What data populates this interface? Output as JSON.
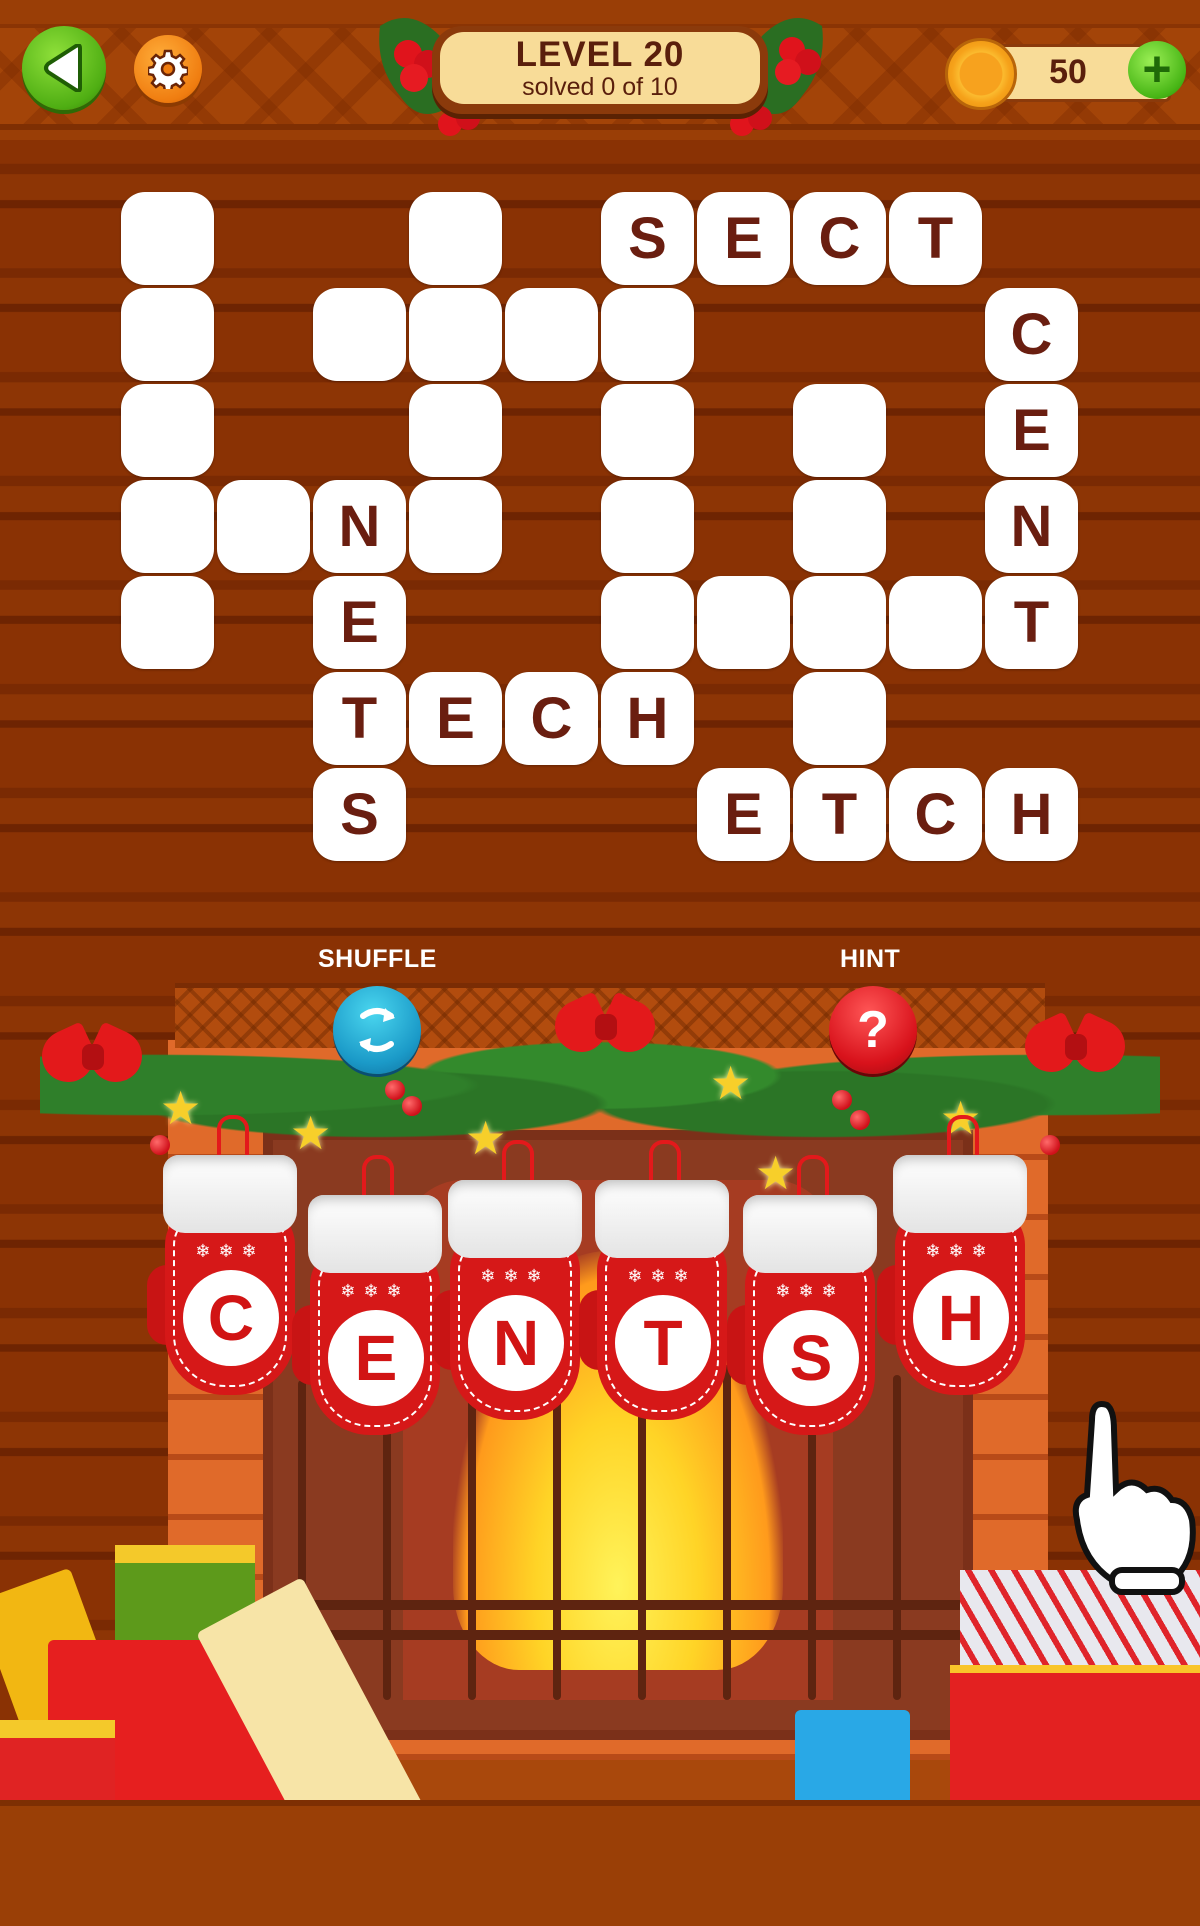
{
  "header": {
    "back_icon": "back-arrow-icon",
    "settings_icon": "gear-icon",
    "level_title": "LEVEL 20",
    "progress_text": "solved 0 of 10",
    "solved": 0,
    "total": 10,
    "coins": "50",
    "coin_icon": "coin-icon",
    "add_coins_icon": "plus-icon"
  },
  "grid": {
    "columns": 10,
    "rows": 7,
    "cells": [
      {
        "r": 0,
        "c": 0,
        "letter": ""
      },
      {
        "r": 0,
        "c": 3,
        "letter": ""
      },
      {
        "r": 0,
        "c": 5,
        "letter": "S"
      },
      {
        "r": 0,
        "c": 6,
        "letter": "E"
      },
      {
        "r": 0,
        "c": 7,
        "letter": "C"
      },
      {
        "r": 0,
        "c": 8,
        "letter": "T"
      },
      {
        "r": 1,
        "c": 0,
        "letter": ""
      },
      {
        "r": 1,
        "c": 2,
        "letter": ""
      },
      {
        "r": 1,
        "c": 3,
        "letter": ""
      },
      {
        "r": 1,
        "c": 4,
        "letter": ""
      },
      {
        "r": 1,
        "c": 5,
        "letter": ""
      },
      {
        "r": 1,
        "c": 9,
        "letter": "C"
      },
      {
        "r": 2,
        "c": 0,
        "letter": ""
      },
      {
        "r": 2,
        "c": 3,
        "letter": ""
      },
      {
        "r": 2,
        "c": 5,
        "letter": ""
      },
      {
        "r": 2,
        "c": 7,
        "letter": ""
      },
      {
        "r": 2,
        "c": 9,
        "letter": "E"
      },
      {
        "r": 3,
        "c": 0,
        "letter": ""
      },
      {
        "r": 3,
        "c": 1,
        "letter": ""
      },
      {
        "r": 3,
        "c": 2,
        "letter": "N"
      },
      {
        "r": 3,
        "c": 3,
        "letter": ""
      },
      {
        "r": 3,
        "c": 5,
        "letter": ""
      },
      {
        "r": 3,
        "c": 7,
        "letter": ""
      },
      {
        "r": 3,
        "c": 9,
        "letter": "N"
      },
      {
        "r": 4,
        "c": 0,
        "letter": ""
      },
      {
        "r": 4,
        "c": 2,
        "letter": "E"
      },
      {
        "r": 4,
        "c": 5,
        "letter": ""
      },
      {
        "r": 4,
        "c": 6,
        "letter": ""
      },
      {
        "r": 4,
        "c": 7,
        "letter": ""
      },
      {
        "r": 4,
        "c": 8,
        "letter": ""
      },
      {
        "r": 4,
        "c": 9,
        "letter": "T"
      },
      {
        "r": 5,
        "c": 2,
        "letter": "T"
      },
      {
        "r": 5,
        "c": 3,
        "letter": "E"
      },
      {
        "r": 5,
        "c": 4,
        "letter": "C"
      },
      {
        "r": 5,
        "c": 5,
        "letter": "H"
      },
      {
        "r": 5,
        "c": 7,
        "letter": ""
      },
      {
        "r": 6,
        "c": 2,
        "letter": "S"
      },
      {
        "r": 6,
        "c": 6,
        "letter": "E"
      },
      {
        "r": 6,
        "c": 7,
        "letter": "T"
      },
      {
        "r": 6,
        "c": 8,
        "letter": "C"
      },
      {
        "r": 6,
        "c": 9,
        "letter": "H"
      }
    ]
  },
  "controls": {
    "shuffle_label": "SHUFFLE",
    "shuffle_icon": "shuffle-icon",
    "hint_label": "HINT",
    "hint_icon": "question-mark-icon",
    "hint_glyph": "?"
  },
  "letters": [
    "C",
    "E",
    "N",
    "T",
    "S",
    "H"
  ],
  "mitten_flakes": "❄❄❄",
  "tutorial_icon": "pointing-hand-icon",
  "colors": {
    "background_wood": "#8a3204",
    "tile": "#ffffff",
    "tile_letter": "#6a1e10",
    "mitten_red": "#d61818",
    "level_plate": "#f8dc98",
    "shuffle_blue": "#1b9ac8",
    "hint_red": "#d8121b",
    "back_green": "#4fae13",
    "settings_orange": "#f07d10"
  }
}
